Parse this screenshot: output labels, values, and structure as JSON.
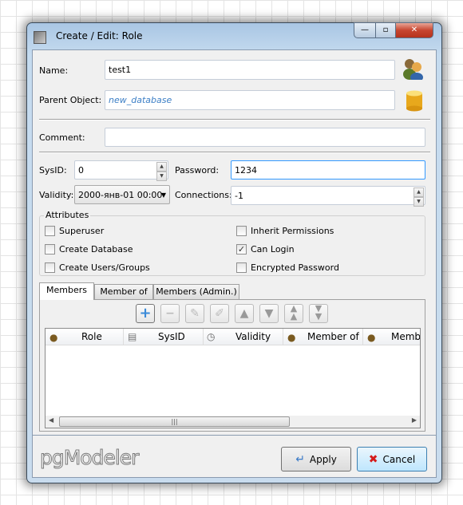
{
  "window": {
    "title": "Create / Edit: Role",
    "minimize": "—",
    "maximize": "▫",
    "close": "✕"
  },
  "form": {
    "name_label": "Name:",
    "name_value": "test1",
    "parent_label": "Parent Object:",
    "parent_value": "new_database",
    "comment_label": "Comment:",
    "comment_value": "",
    "sysid_label": "SysID:",
    "sysid_value": "0",
    "password_label": "Password:",
    "password_value": "1234",
    "validity_label": "Validity:",
    "validity_value": "2000-янв-01 00:00",
    "connections_label": "Connections:",
    "connections_value": "-1"
  },
  "attributes": {
    "title": "Attributes",
    "items": [
      {
        "label": "Superuser",
        "checked": false
      },
      {
        "label": "Inherit Permissions",
        "checked": false
      },
      {
        "label": "Create Database",
        "checked": false
      },
      {
        "label": "Can Login",
        "checked": true
      },
      {
        "label": "Create Users/Groups",
        "checked": false
      },
      {
        "label": "Encrypted Password",
        "checked": false
      }
    ]
  },
  "tabs": [
    "Members",
    "Member of",
    "Members (Admin.)"
  ],
  "active_tab": "Members",
  "toolbar": [
    "add-icon",
    "remove-icon",
    "clear-icon",
    "edit-icon",
    "move-up-icon",
    "move-down-icon",
    "move-top-icon",
    "move-bottom-icon"
  ],
  "table": {
    "columns": [
      "Role",
      "SysID",
      "Validity",
      "Member of",
      "Membe"
    ]
  },
  "footer": {
    "logo": "pgModeler",
    "apply": "Apply",
    "cancel": "Cancel"
  },
  "colors": {
    "italic_link": "#3c7fc6",
    "accent": "#3399ff"
  }
}
